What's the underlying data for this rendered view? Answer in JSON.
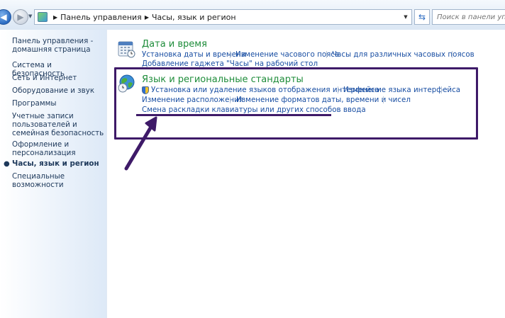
{
  "breadcrumb": {
    "items": [
      "Панель управления",
      "Часы, язык и регион"
    ]
  },
  "search": {
    "placeholder": "Поиск в панели управления"
  },
  "sidebar": {
    "items": [
      {
        "label": "Панель управления - домашняя страница"
      },
      {
        "label": "Система и безопасность"
      },
      {
        "label": "Сеть и Интернет"
      },
      {
        "label": "Оборудование и звук"
      },
      {
        "label": "Программы"
      },
      {
        "label": "Учетные записи пользователей и семейная безопасность"
      },
      {
        "label": "Оформление и персонализация"
      },
      {
        "label": "Часы, язык и регион",
        "current": true
      },
      {
        "label": "Специальные возможности"
      }
    ]
  },
  "categories": [
    {
      "title": "Дата и время",
      "icon": "calendar-clock-icon",
      "links": [
        "Установка даты и времени",
        "Изменение часового пояса",
        "Часы для различных часовых поясов",
        "Добавление гаджета \"Часы\" на рабочий стол"
      ]
    },
    {
      "title": "Язык и региональные стандарты",
      "icon": "globe-clock-icon",
      "links": [
        "Установка или удаление языков отображения интерфейса",
        "Изменение языка интерфейса",
        "Изменение расположения",
        "Изменение форматов даты, времени и чисел",
        "Смена раскладки клавиатуры или других способов ввода"
      ]
    }
  ],
  "colors": {
    "category_title": "#1e8c3a",
    "link": "#1a4fa3",
    "annotation": "#3e1a68"
  }
}
